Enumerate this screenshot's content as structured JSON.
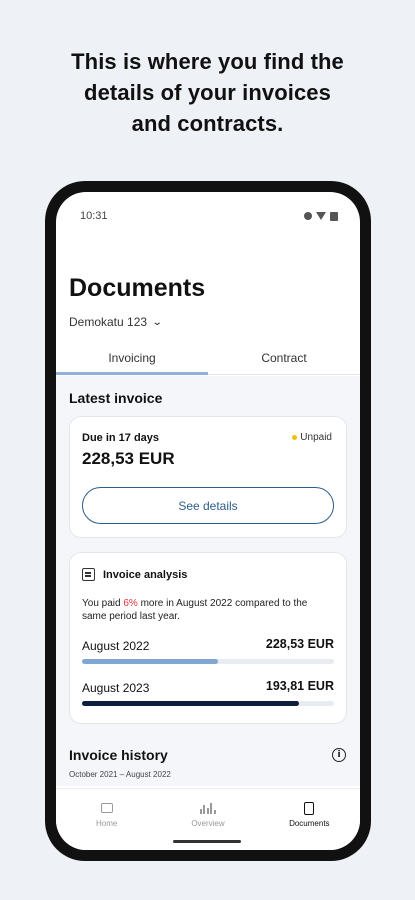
{
  "headline": "This is where you find the\ndetails of your invoices\nand contracts.",
  "status_bar": {
    "time": "10:31"
  },
  "page": {
    "title": "Documents",
    "address": "Demokatu 123"
  },
  "tabs": [
    {
      "label": "Invoicing",
      "active": true
    },
    {
      "label": "Contract",
      "active": false
    }
  ],
  "latest_invoice": {
    "section_title": "Latest invoice",
    "due": "Due in 17 days",
    "amount": "228,53 EUR",
    "status": "Unpaid",
    "status_color": "#f2c200",
    "button_label": "See details"
  },
  "analysis": {
    "title": "Invoice analysis",
    "text_before": "You paid ",
    "highlight": "6%",
    "text_after": " more in August 2022 compared to the same period last year.",
    "rows": [
      {
        "label": "August 2022",
        "value": "228,53 EUR",
        "fill_fraction": 0.54,
        "color": "#7fa7d2"
      },
      {
        "label": "August 2023",
        "value": "193,81 EUR",
        "fill_fraction": 0.86,
        "color": "#0f1e3d"
      }
    ]
  },
  "history": {
    "title": "Invoice history",
    "range": "October 2021 – August 2022"
  },
  "bottom_nav": [
    {
      "label": "Home",
      "icon": "home-icon",
      "active": false
    },
    {
      "label": "Overview",
      "icon": "bar-chart-icon",
      "active": false
    },
    {
      "label": "Documents",
      "icon": "document-icon",
      "active": true
    }
  ],
  "colors": {
    "background": "#eef1f6",
    "accent": "#2f5d8a",
    "tab_indicator": "#8fb3d9",
    "highlight_red": "#e0303a"
  }
}
